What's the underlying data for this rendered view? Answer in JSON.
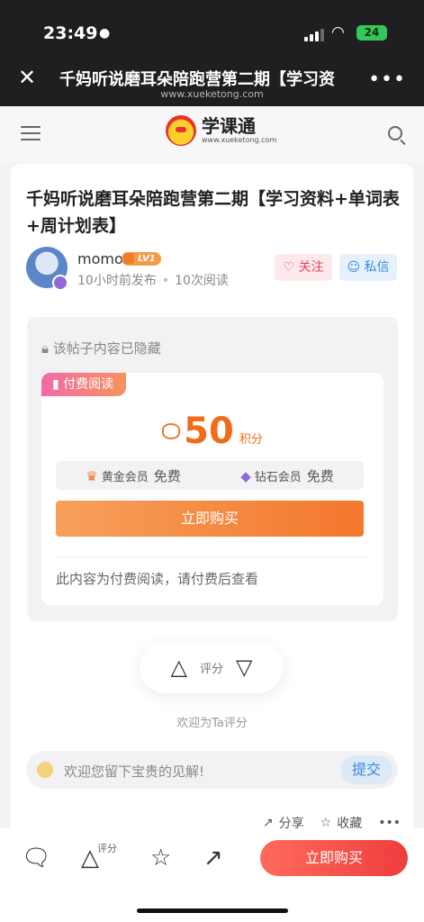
{
  "status": {
    "time": "23:49",
    "battery": "24"
  },
  "browser": {
    "title": "千妈听说磨耳朵陪跑营第二期【学习资",
    "url": "www.xueketong.com"
  },
  "site": {
    "logo_cn": "学课通",
    "logo_en": "www.xueketong.com"
  },
  "article": {
    "title": "千妈听说磨耳朵陪跑营第二期【学习资料+单词表+周计划表】",
    "author": "momo",
    "level": "LV1",
    "posted": "10小时前发布",
    "reads": "10次阅读",
    "follow_label": "关注",
    "message_label": "私信"
  },
  "paywall": {
    "hidden_notice": "该帖子内容已隐藏",
    "tag": "付费阅读",
    "price": "50",
    "unit": "积分",
    "gold_member": "黄金会员",
    "gold_price": "免费",
    "diamond_member": "钻石会员",
    "diamond_price": "免费",
    "buy_label": "立即购买",
    "note": "此内容为付费阅读，请付费后查看"
  },
  "rating": {
    "label": "评分",
    "hint": "欢迎为Ta评分"
  },
  "comment": {
    "placeholder": "欢迎您留下宝贵的见解!",
    "submit": "提交"
  },
  "actions": {
    "share": "分享",
    "favorite": "收藏"
  },
  "bottom": {
    "rate_label": "评分",
    "buy_label": "立即购买"
  }
}
